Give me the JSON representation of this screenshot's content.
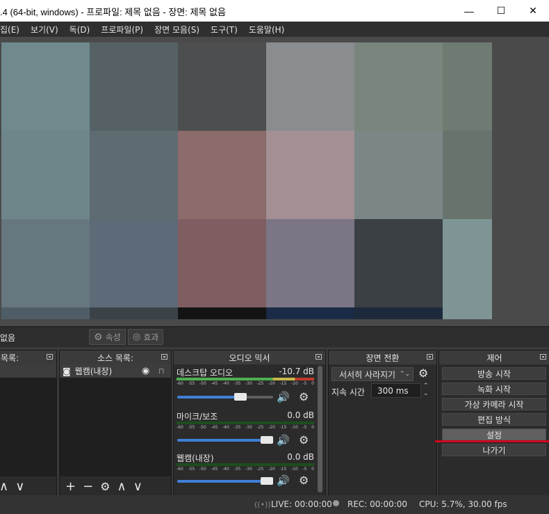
{
  "window": {
    "title": ".4 (64-bit, windows) - 프로파일: 제목 없음 - 장면: 제목 없음",
    "minimize": "—",
    "maximize": "☐",
    "close": "✕"
  },
  "menu": {
    "items": [
      "집(E)",
      "보기(V)",
      "독(D)",
      "프로파일(P)",
      "장면 모음(S)",
      "도구(T)",
      "도움말(H)"
    ]
  },
  "preview": {
    "tiles": [
      [
        "#6f898d",
        "#556164",
        "#4d4e50",
        "#8a8d8f",
        "#7a857d",
        "#6e7b72"
      ],
      [
        "#6e868a",
        "#5e6b71",
        "#8c6b6b",
        "#a48f95",
        "#7b8786",
        "#66746d"
      ],
      [
        "#667780",
        "#5d6a78",
        "#7f5e62",
        "#7b7585",
        "#3a4044",
        "#7f9595"
      ]
    ],
    "bottom_strip": [
      "#4f5e66",
      "#3c4348",
      "#141414",
      "#1b2a46",
      "#1c2a3c",
      "#7f9595"
    ]
  },
  "scene_toolbar": {
    "scene_name": "없음",
    "properties": "속성",
    "filters": "효과"
  },
  "scenes_dock": {
    "title": "목록:",
    "footer_icons": [
      "chevron-up-icon",
      "chevron-down-icon"
    ]
  },
  "sources_dock": {
    "title": "소스 목록:",
    "items": [
      {
        "label": "웹캠(내장)"
      }
    ]
  },
  "mixer_dock": {
    "title": "오디오 믹서",
    "ticks": [
      "-60",
      "-55",
      "-50",
      "-45",
      "-40",
      "-35",
      "-30",
      "-25",
      "-20",
      "-15",
      "-10",
      "-5",
      "0"
    ],
    "tracks": [
      {
        "name": "데스크탑 오디오",
        "db": "-10.7 dB",
        "volume": 0.68
      },
      {
        "name": "마이크/보조",
        "db": "0.0 dB",
        "volume": 1.0
      },
      {
        "name": "웹캠(내장)",
        "db": "0.0 dB",
        "volume": 1.0
      }
    ]
  },
  "transitions_dock": {
    "title": "장면 전환",
    "transition": "서서히 사라지기",
    "duration_label": "지속 시간",
    "duration_value": "300 ms"
  },
  "controls_dock": {
    "title": "제어",
    "buttons": [
      "방송 시작",
      "녹화 시작",
      "가상 카메라 시작",
      "편집 방식",
      "설정",
      "나가기"
    ]
  },
  "status": {
    "live": "LIVE: 00:00:00",
    "rec": "REC: 00:00:00",
    "cpu": "CPU: 5.7%, 30.00 fps"
  },
  "colors": {
    "annotation_underline": "#d0021b",
    "volume_fill": "#3f7fd6"
  }
}
